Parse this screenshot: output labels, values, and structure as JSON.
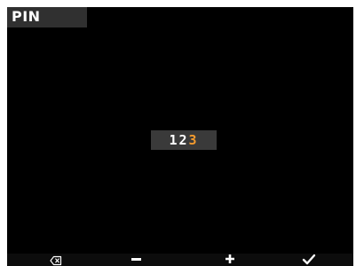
{
  "header": {
    "title": "PIN"
  },
  "pin": {
    "entered": "12",
    "active": "3"
  },
  "softkeys": {
    "backspace_icon": "backspace-icon",
    "minus_icon": "minus-icon",
    "plus_icon": "plus-icon",
    "confirm_icon": "checkmark-icon"
  },
  "colors": {
    "background": "#000000",
    "title_tab": "#303030",
    "pin_box": "#3a3a3a",
    "active_digit": "#f29a2e",
    "text": "#ffffff"
  }
}
